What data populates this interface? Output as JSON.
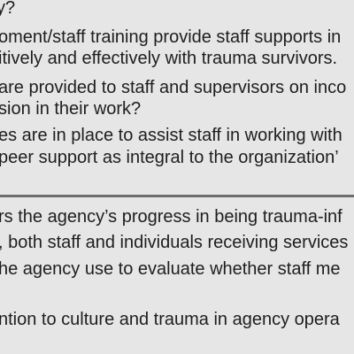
{
  "upper_section": {
    "lines": [
      "y?",
      "oment/staff training provide staff supports in",
      "itively and effectively with trauma survivors.",
      "are provided to staff and supervisors on inco",
      "sion in their work?",
      "es are in place to assist staff in working with",
      " peer support as integral to the organization’"
    ]
  },
  "lower_section": {
    "lines": [
      "rs the agency’s progress in being trauma-inf",
      ", both staff and individuals receiving services",
      "he agency use to evaluate whether staff me",
      "ntion to culture and trauma in agency opera"
    ]
  }
}
